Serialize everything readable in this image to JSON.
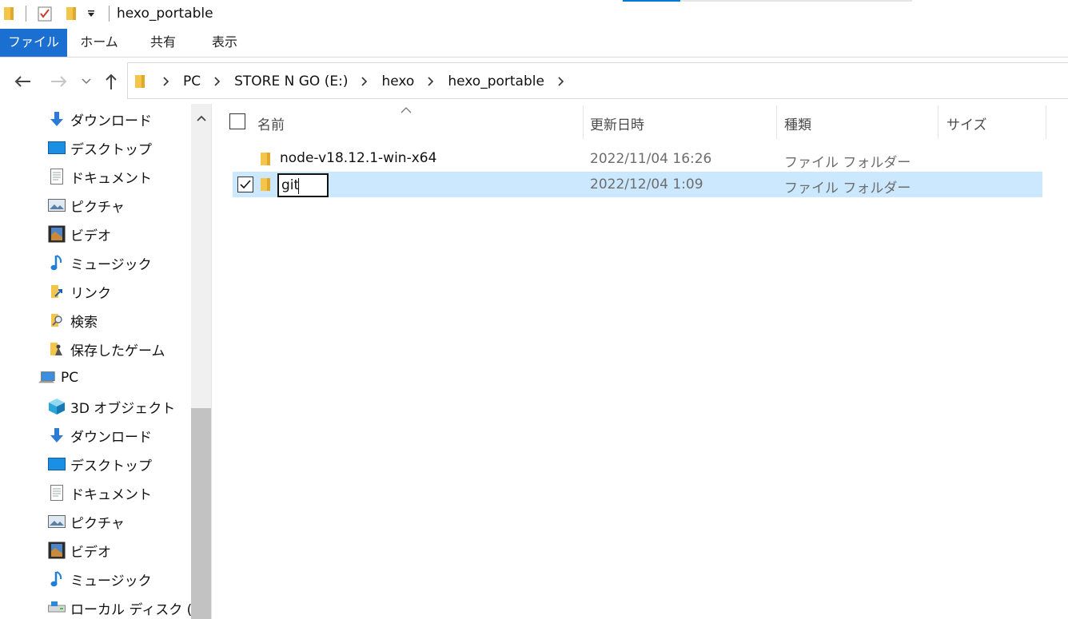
{
  "window": {
    "title": "hexo_portable"
  },
  "quick_access": {
    "icons": [
      "folder-icon",
      "properties-check-icon",
      "new-folder-icon",
      "customize-dropdown-icon"
    ]
  },
  "ribbon": {
    "tabs": [
      {
        "label": "ファイル",
        "active": true
      },
      {
        "label": "ホーム"
      },
      {
        "label": "共有"
      },
      {
        "label": "表示"
      }
    ]
  },
  "address": {
    "crumbs": [
      "PC",
      "STORE N GO (E:)",
      "hexo",
      "hexo_portable"
    ]
  },
  "sidebar": {
    "items": [
      {
        "label": "ダウンロード",
        "icon": "download-arrow-icon"
      },
      {
        "label": "デスクトップ",
        "icon": "desktop-icon"
      },
      {
        "label": "ドキュメント",
        "icon": "document-icon"
      },
      {
        "label": "ピクチャ",
        "icon": "pictures-icon"
      },
      {
        "label": "ビデオ",
        "icon": "video-icon"
      },
      {
        "label": "ミュージック",
        "icon": "music-note-icon"
      },
      {
        "label": "リンク",
        "icon": "links-folder-icon"
      },
      {
        "label": "検索",
        "icon": "search-folder-icon"
      },
      {
        "label": "保存したゲーム",
        "icon": "saved-games-icon"
      },
      {
        "label": "PC",
        "icon": "pc-icon"
      },
      {
        "label": "3D オブジェクト",
        "icon": "3d-objects-icon"
      },
      {
        "label": "ダウンロード",
        "icon": "download-arrow-icon"
      },
      {
        "label": "デスクトップ",
        "icon": "desktop-icon"
      },
      {
        "label": "ドキュメント",
        "icon": "document-icon"
      },
      {
        "label": "ピクチャ",
        "icon": "pictures-icon"
      },
      {
        "label": "ビデオ",
        "icon": "video-icon"
      },
      {
        "label": "ミュージック",
        "icon": "music-note-icon"
      },
      {
        "label": "ローカル ディスク (C:)",
        "icon": "local-disk-icon"
      }
    ]
  },
  "columns": {
    "name": "名前",
    "modified": "更新日時",
    "type": "種類",
    "size": "サイズ"
  },
  "files": [
    {
      "name": "node-v18.12.1-win-x64",
      "modified": "2022/11/04 16:26",
      "type": "ファイル フォルダー",
      "size": "",
      "selected": false
    },
    {
      "name": "git",
      "modified": "2022/12/04 1:09",
      "type": "ファイル フォルダー",
      "size": "",
      "selected": true,
      "renaming": true
    }
  ],
  "colors": {
    "accent": "#1a6fd1",
    "selection": "#cce8ff",
    "folder": "#f3c64b"
  }
}
